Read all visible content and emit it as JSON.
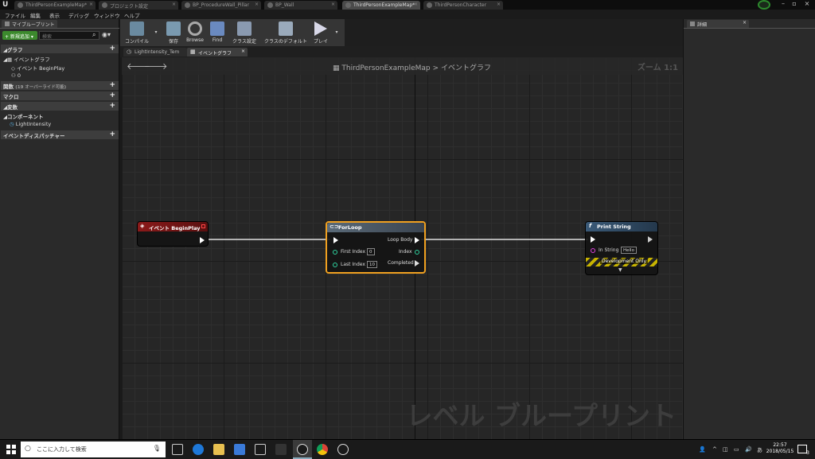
{
  "tabs": [
    {
      "label": "ThirdPersonExampleMap*",
      "active": false
    },
    {
      "label": "プロジェクト設定",
      "active": false
    },
    {
      "label": "BP_ProcedureWall_Pillar",
      "active": false
    },
    {
      "label": "BP_Wall",
      "active": false
    },
    {
      "label": "ThirdPersonExampleMap*",
      "active": true
    },
    {
      "label": "ThirdPersonCharacter",
      "active": false
    }
  ],
  "menu": [
    "ファイル",
    "編集",
    "表示",
    "デバッグ",
    "ウィンドウ",
    "ヘルプ"
  ],
  "left_panel": {
    "tab_label": "マイブループリント",
    "add_button": "+ 新規追加 ▾",
    "search_placeholder": "検索",
    "graph_section": "グラフ",
    "event_graph_item": "イベントグラフ",
    "begin_play_item": "イベント BeginPlay",
    "loop_count": "0",
    "functions_section": "関数",
    "functions_note": "(19 オーバーライド可能)",
    "macros_section": "マクロ",
    "variables_section": "変数",
    "components_section": "コンポーネント",
    "component_item": "LightIntensity",
    "dispatchers_section": "イベントディスパッチャー"
  },
  "toolbar": {
    "compile": "コンパイル",
    "save": "保存",
    "browse": "Browse",
    "find": "Find",
    "class_settings": "クラス設定",
    "class_defaults": "クラスのデフォルト",
    "play": "プレイ"
  },
  "graph_tabs": [
    "LightIntensity_Tem",
    "イベントグラフ"
  ],
  "breadcrumb": {
    "map": "ThirdPersonExampleMap",
    "sep": ">",
    "graph": "イベントグラフ"
  },
  "zoom": "ズーム 1:1",
  "watermark": "レベル ブループリント",
  "nodes": {
    "begin_play": {
      "title": "イベント BeginPlay"
    },
    "for_loop": {
      "title": "ForLoop",
      "first_index_label": "First Index",
      "first_index_value": "0",
      "last_index_label": "Last Index",
      "last_index_value": "10",
      "loop_body": "Loop Body",
      "index": "Index",
      "completed": "Completed"
    },
    "print_string": {
      "title": "Print String",
      "in_string_label": "In String",
      "in_string_value": "Hello",
      "dev_only": "Development Only"
    }
  },
  "details_panel": {
    "tab_label": "詳細"
  },
  "taskbar": {
    "search_placeholder": "ここに入力して検索",
    "time": "22:57",
    "date": "2018/05/15",
    "notification_count": "3"
  },
  "colors": {
    "begin_play_header": "#8b1a1a",
    "for_loop_header": "#5a6a78",
    "for_loop_border": "#f0a020",
    "print_string_header": "#3a5a78",
    "add_button": "#3c8a2d"
  }
}
